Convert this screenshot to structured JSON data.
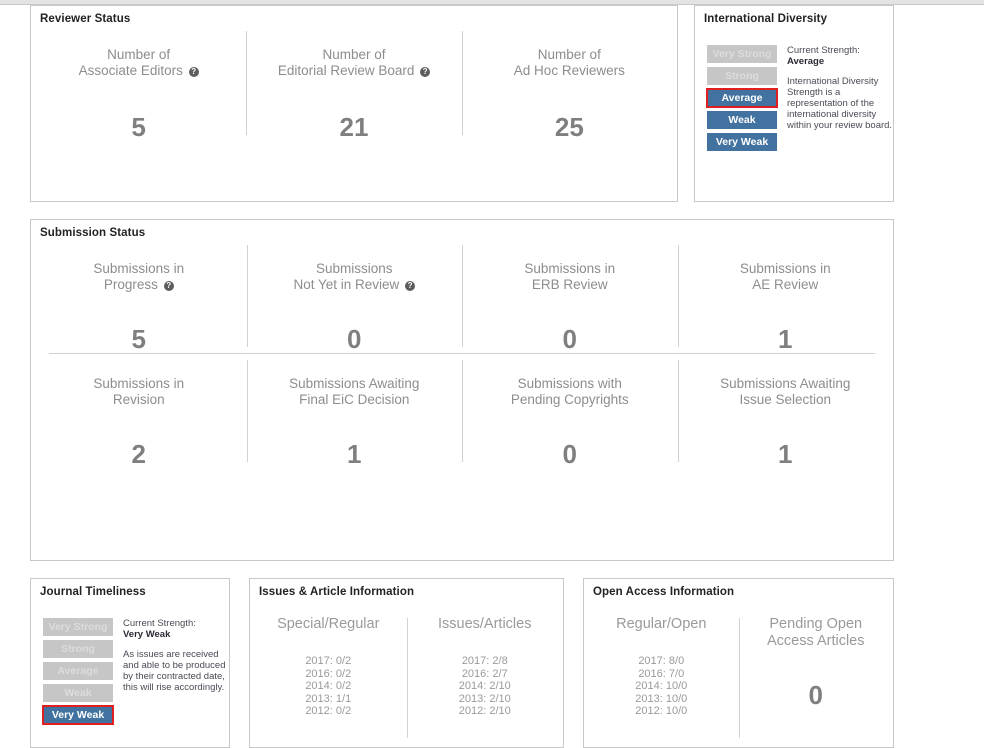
{
  "reviewer_status": {
    "title": "Reviewer Status",
    "stats": [
      {
        "label_line1": "Number of",
        "label_line2": "Associate Editors",
        "has_help": true,
        "value": "5"
      },
      {
        "label_line1": "Number of",
        "label_line2": "Editorial Review Board",
        "has_help": true,
        "value": "21"
      },
      {
        "label_line1": "Number of",
        "label_line2": "Ad Hoc Reviewers",
        "has_help": false,
        "value": "25"
      }
    ]
  },
  "international_diversity": {
    "title": "International Diversity",
    "bars": [
      {
        "label": "Very Strong",
        "state": "off"
      },
      {
        "label": "Strong",
        "state": "off"
      },
      {
        "label": "Average",
        "state": "on"
      },
      {
        "label": "Weak",
        "state": "on"
      },
      {
        "label": "Very Weak",
        "state": "on"
      }
    ],
    "current_index": 2,
    "current_label": "Current Strength:",
    "current_value": "Average",
    "description": "International Diversity Strength is a representation of the international diversity within your review board."
  },
  "submission_status": {
    "title": "Submission Status",
    "row1": [
      {
        "label_line1": "Submissions in",
        "label_line2": "Progress",
        "has_help": true,
        "value": "5"
      },
      {
        "label_line1": "Submissions",
        "label_line2": "Not Yet in Review",
        "has_help": true,
        "value": "0"
      },
      {
        "label_line1": "Submissions in",
        "label_line2": "ERB Review",
        "has_help": false,
        "value": "0"
      },
      {
        "label_line1": "Submissions in",
        "label_line2": "AE Review",
        "has_help": false,
        "value": "1"
      }
    ],
    "row2": [
      {
        "label_line1": "Submissions in",
        "label_line2": "Revision",
        "has_help": false,
        "value": "2"
      },
      {
        "label_line1": "Submissions Awaiting",
        "label_line2": "Final EiC Decision",
        "has_help": false,
        "value": "1"
      },
      {
        "label_line1": "Submissions with",
        "label_line2": "Pending Copyrights",
        "has_help": false,
        "value": "0"
      },
      {
        "label_line1": "Submissions Awaiting",
        "label_line2": "Issue Selection",
        "has_help": false,
        "value": "1"
      }
    ]
  },
  "journal_timeliness": {
    "title": "Journal Timeliness",
    "bars": [
      {
        "label": "Very Strong",
        "state": "off"
      },
      {
        "label": "Strong",
        "state": "off"
      },
      {
        "label": "Average",
        "state": "off"
      },
      {
        "label": "Weak",
        "state": "off"
      },
      {
        "label": "Very Weak",
        "state": "on"
      }
    ],
    "current_index": 4,
    "current_label": "Current Strength:",
    "current_value": "Very Weak",
    "description": "As issues are received and able to be produced by their contracted date, this will rise accordingly."
  },
  "issues_articles": {
    "title": "Issues & Article Information",
    "columns": [
      {
        "head_line1": "Special/Regular",
        "head_line2": "",
        "rows": [
          "2017: 0/2",
          "2016: 0/2",
          "2014: 0/2",
          "2013: 1/1",
          "2012: 0/2"
        ]
      },
      {
        "head_line1": "Issues/Articles",
        "head_line2": "",
        "rows": [
          "2017: 2/8",
          "2016: 2/7",
          "2014: 2/10",
          "2013: 2/10",
          "2012: 2/10"
        ]
      }
    ]
  },
  "open_access": {
    "title": "Open Access Information",
    "columns": [
      {
        "head_line1": "Regular/Open",
        "head_line2": "",
        "rows": [
          "2017: 8/0",
          "2016: 7/0",
          "2014: 10/0",
          "2013: 10/0",
          "2012: 10/0"
        ],
        "big_value": ""
      },
      {
        "head_line1": "Pending Open",
        "head_line2": "Access Articles",
        "rows": [],
        "big_value": "0"
      }
    ]
  },
  "colors": {
    "accent_blue": "#42729f",
    "inactive_gray": "#c6c6c6",
    "current_outline_red": "#e02020",
    "panel_border": "#c8c8c8",
    "value_gray": "#7f7f7f",
    "label_gray": "#8d8d8d"
  },
  "icons": {
    "help": "?"
  }
}
